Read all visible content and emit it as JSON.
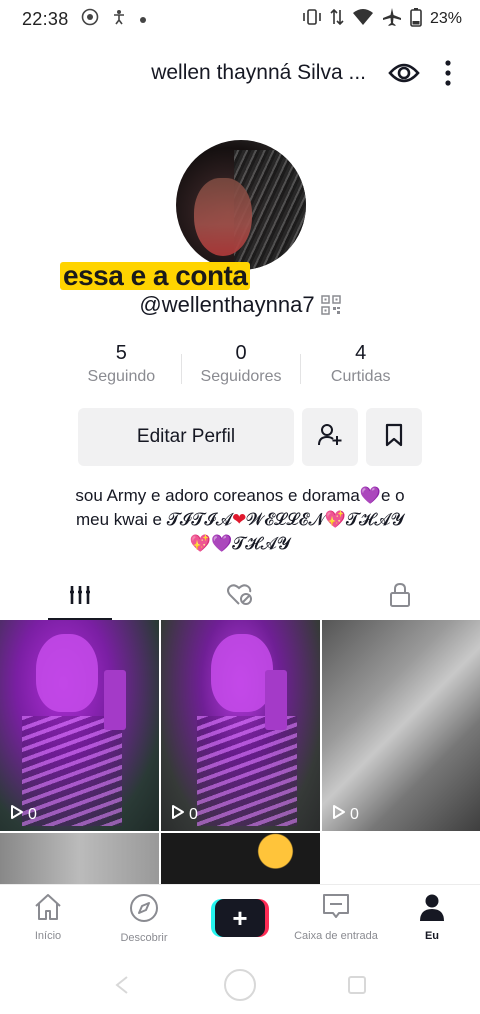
{
  "status_bar": {
    "time": "22:38",
    "battery": "23%",
    "icons": [
      "whatsapp-icon",
      "accessibility-icon",
      "dot-icon",
      "vibrate-icon",
      "data-icon",
      "wifi-icon",
      "airplane-icon",
      "battery-icon"
    ]
  },
  "header": {
    "title": "wellen thaynná Silva ...",
    "icons": [
      "eye-icon",
      "more-vertical-icon"
    ]
  },
  "profile": {
    "avatar_caption": "essa e a conta",
    "username": "@wellenthaynna7"
  },
  "stats": [
    {
      "value": "5",
      "label": "Seguindo"
    },
    {
      "value": "0",
      "label": "Seguidores"
    },
    {
      "value": "4",
      "label": "Curtidas"
    }
  ],
  "actions": {
    "edit_label": "Editar Perfil"
  },
  "bio": {
    "line1_text": "sou Army e adoro coreanos e dorama",
    "line1_heart": "💜",
    "line1_end": "e o",
    "line2_text": "meu kwai e ",
    "line2_fancy1": "𝓣𝓘𝓣𝓘𝓐",
    "line2_heart_red": "❤",
    "line2_fancy2": "𝓦𝓔𝓛𝓛𝓔𝓝",
    "line2_heart_pink": "💖",
    "line2_fancy3": "𝓣𝓗𝓐𝓨",
    "line3_heart_pink": "💖",
    "line3_heart_purple": "💜",
    "line3_fancy": "𝓣𝓗𝓐𝓨"
  },
  "tabs": [
    {
      "icon": "grid-icon",
      "active": true
    },
    {
      "icon": "liked-hidden-icon",
      "active": false
    },
    {
      "icon": "lock-icon",
      "active": false
    }
  ],
  "videos": [
    {
      "views": "0"
    },
    {
      "views": "0"
    },
    {
      "views": "0"
    }
  ],
  "bottom_nav": [
    {
      "label": "Início",
      "icon": "home-icon"
    },
    {
      "label": "Descobrir",
      "icon": "compass-icon"
    },
    {
      "label": "",
      "icon": "plus-icon"
    },
    {
      "label": "Caixa de entrada",
      "icon": "inbox-icon"
    },
    {
      "label": "Eu",
      "icon": "profile-icon"
    }
  ],
  "colors": {
    "accent_pink": "#fe2c55",
    "accent_cyan": "#25f4ee",
    "text_primary": "#161823",
    "text_secondary": "#8a8b91",
    "button_bg": "#f1f1f2"
  }
}
